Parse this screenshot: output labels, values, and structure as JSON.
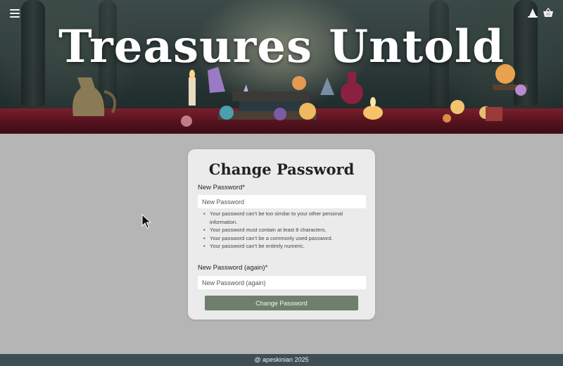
{
  "header": {
    "site_title": "Treasures Untold",
    "menu_icon": "hamburger-menu-icon",
    "account_icon": "wizard-hat-icon",
    "cart_icon": "basket-icon"
  },
  "form": {
    "title": "Change Password",
    "new_password_label": "New Password*",
    "new_password_placeholder": "New Password",
    "help_items": [
      "Your password can’t be too similar to your other personal information.",
      "Your password must contain at least 8 characters.",
      "Your password can’t be a commonly used password.",
      "Your password can’t be entirely numeric."
    ],
    "confirm_password_label": "New Password (again)*",
    "confirm_password_placeholder": "New Password (again)",
    "submit_label": "Change Password"
  },
  "footer": {
    "text": "@ apeskinian 2025"
  },
  "colors": {
    "page_background": "#b5b5b5",
    "card_background": "#eeeeee",
    "button": "#6e7f6c",
    "footer": "#3d4e55"
  }
}
